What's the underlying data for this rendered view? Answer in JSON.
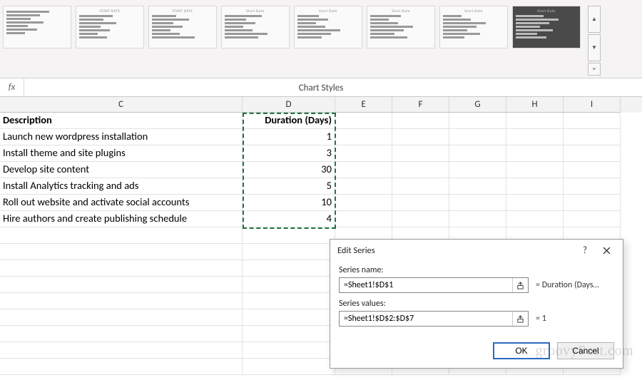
{
  "ribbon": {
    "group_label": "Chart Styles",
    "thumbs": [
      {
        "title": ""
      },
      {
        "title": "START DATE"
      },
      {
        "title": "START DATE"
      },
      {
        "title": "Start Date"
      },
      {
        "title": "Start Date"
      },
      {
        "title": "Start Date"
      },
      {
        "title": "Start Date"
      },
      {
        "title": "Start Date"
      }
    ]
  },
  "formula_bar": {
    "fx": "fx",
    "value": ""
  },
  "columns": [
    "C",
    "D",
    "E",
    "F",
    "G",
    "H",
    "I"
  ],
  "headers": {
    "c": "Description",
    "d": "Duration (Days)"
  },
  "tasks": [
    {
      "desc": "Launch new wordpress installation",
      "dur": "1"
    },
    {
      "desc": "Install theme and site plugins",
      "dur": "3"
    },
    {
      "desc": "Develop site content",
      "dur": "30"
    },
    {
      "desc": "Install Analytics tracking and ads",
      "dur": "5"
    },
    {
      "desc": "Roll out website and activate social accounts",
      "dur": "10"
    },
    {
      "desc": "Hire authors and create publishing schedule",
      "dur": "4"
    }
  ],
  "blank_rows": 9,
  "dialog": {
    "title": "Edit Series",
    "help": "?",
    "series_name_label": "Series name:",
    "series_name_value": "=Sheet1!$D$1",
    "series_name_eq": "= Duration (Days…",
    "series_values_label": "Series values:",
    "series_values_value": "=Sheet1!$D$2:$D$7",
    "series_values_eq": "= 1",
    "ok": "OK",
    "cancel": "Cancel"
  },
  "watermark": "groovyPost.com",
  "chart_data": {
    "type": "bar",
    "title": "Duration (Days)",
    "categories": [
      "Launch new wordpress installation",
      "Install theme and site plugins",
      "Develop site content",
      "Install Analytics tracking and ads",
      "Roll out website and activate social accounts",
      "Hire authors and create publishing schedule"
    ],
    "values": [
      1,
      3,
      30,
      5,
      10,
      4
    ],
    "xlabel": "",
    "ylabel": "",
    "ylim": [
      0,
      30
    ]
  }
}
